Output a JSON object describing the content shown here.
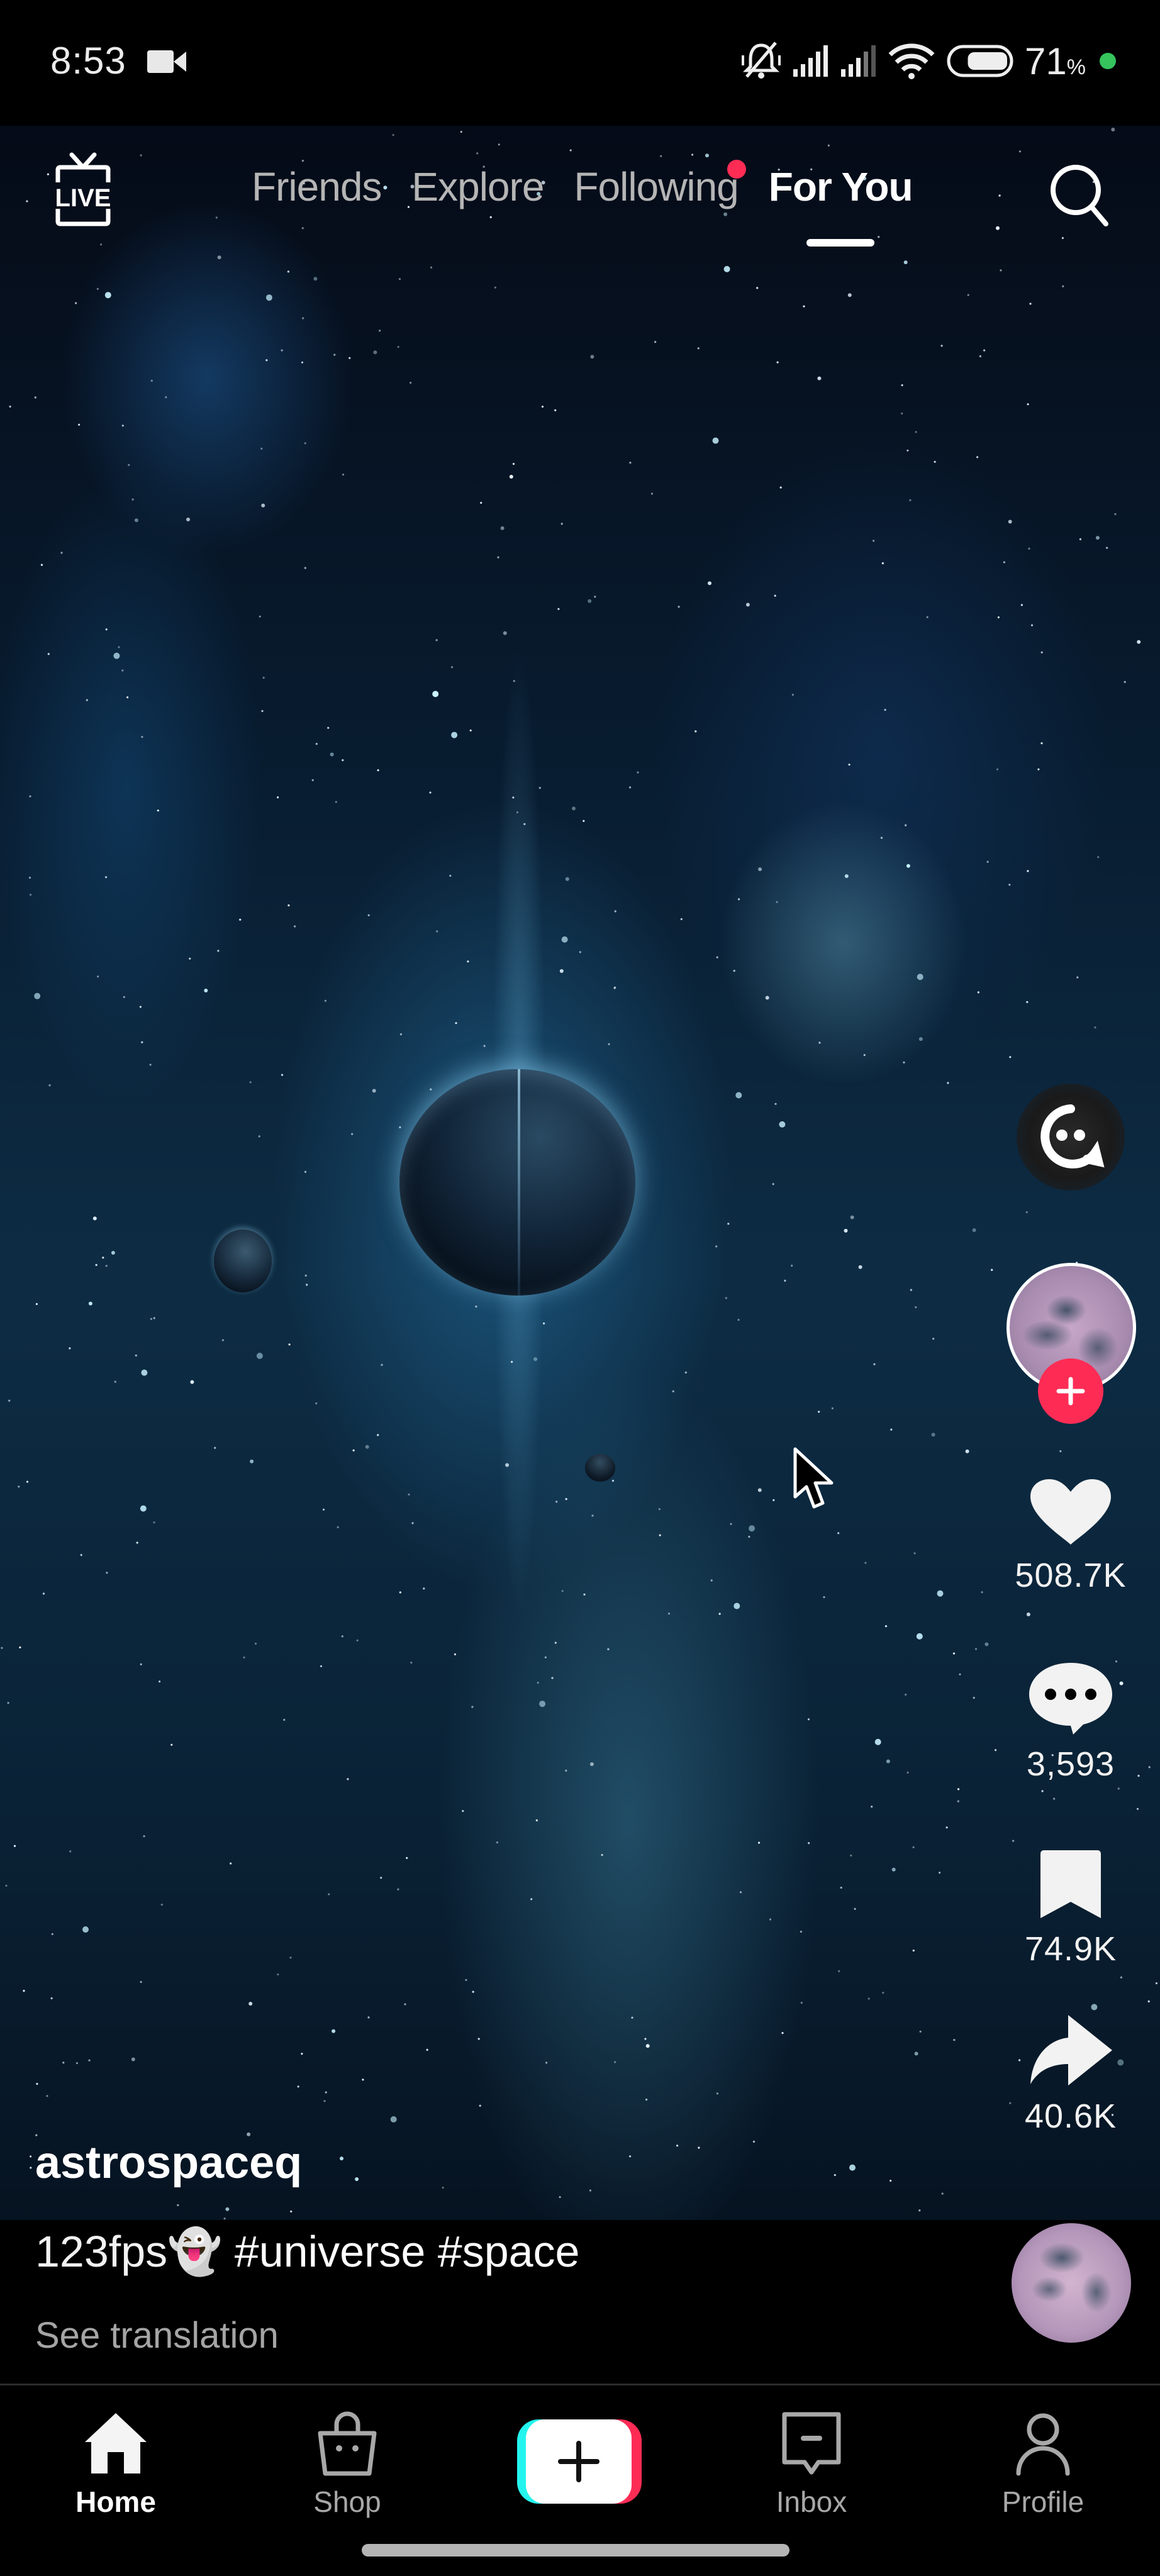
{
  "status_bar": {
    "time": "8:53",
    "recording_icon": "video-camera-icon",
    "icons": [
      "silent-bell-icon",
      "signal-sim1-icon",
      "signal-sim2-icon",
      "wifi-icon",
      "battery-icon"
    ],
    "battery_percent": "71",
    "battery_percent_symbol": "%",
    "battery_level": 0.71,
    "privacy_dot_color": "#36c45d"
  },
  "top_nav": {
    "live_label": "LIVE",
    "tabs": [
      {
        "label": "Friends",
        "active": false
      },
      {
        "label": "Explore",
        "active": false
      },
      {
        "label": "Following",
        "active": false,
        "has_notification_dot": true
      },
      {
        "label": "For You",
        "active": true
      }
    ],
    "notification_dot_color": "#fe2c55"
  },
  "actions": {
    "ai_assistant_icon": "ai-chat-icon",
    "follow_icon": "plus-icon",
    "likes": "508.7K",
    "comments": "3,593",
    "favorites": "74.9K",
    "shares": "40.6K"
  },
  "post": {
    "username": "astrospaceq",
    "caption_prefix": "123fps",
    "caption_emoji": "👻",
    "hashtags": "#universe #space",
    "see_translation": "See translation"
  },
  "bottom_nav": {
    "items": [
      {
        "label": "Home",
        "icon": "home-icon",
        "active": true
      },
      {
        "label": "Shop",
        "icon": "shopping-bag-icon",
        "active": false
      },
      {
        "label": "",
        "icon": "create-plus-icon",
        "active": false
      },
      {
        "label": "Inbox",
        "icon": "inbox-icon",
        "active": false
      },
      {
        "label": "Profile",
        "icon": "profile-icon",
        "active": false
      }
    ]
  },
  "colors": {
    "accent_red": "#fe2c55",
    "accent_cyan": "#25f4ee"
  }
}
